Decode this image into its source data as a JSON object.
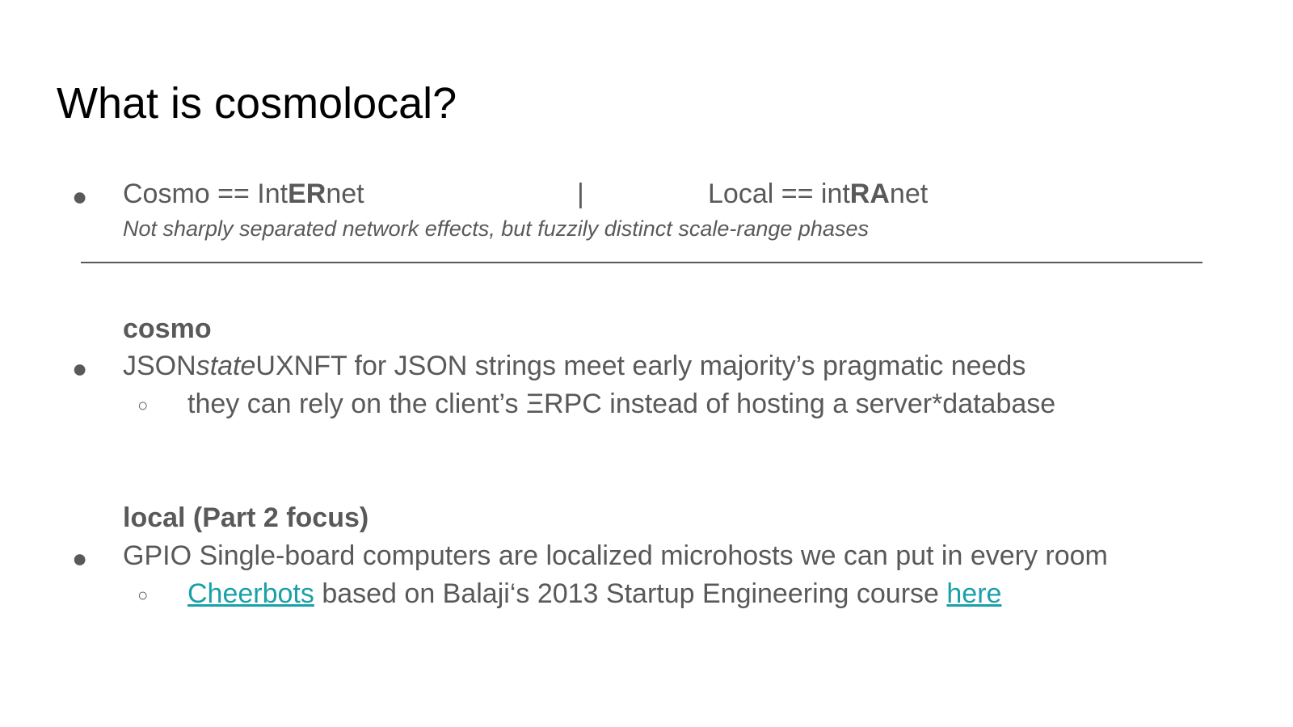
{
  "slide": {
    "title": "What is cosmolocal?",
    "intro": {
      "bullet": "●",
      "left": {
        "prefix": "Cosmo == Int",
        "bold": "ER",
        "suffix": "net"
      },
      "separator": "|",
      "right": {
        "prefix": "Local == int",
        "bold": "RA",
        "suffix": "net"
      },
      "subtitle": "Not sharply separated network effects, but fuzzily distinct scale-range phases"
    },
    "cosmo": {
      "heading": "cosmo",
      "bullet": "●",
      "line_prefix": "JSON",
      "line_italic": "state",
      "line_suffix": "UXNFT for JSON strings meet early majority’s pragmatic needs",
      "sub_bullet": "○",
      "sub_line": "they can rely on the client’s ΞRPC instead of hosting a server*database"
    },
    "local": {
      "heading": "local (Part 2 focus)",
      "bullet": "●",
      "line": "GPIO Single-board computers are localized microhosts we can put in every room",
      "sub_bullet": "○",
      "sub_link_1": "Cheerbots",
      "sub_middle": " based on Balaji‘s 2013 Startup Engineering course ",
      "sub_link_2": "here"
    }
  },
  "colors": {
    "title": "#000000",
    "body_text": "#595959",
    "link": "#1aa0a8"
  }
}
